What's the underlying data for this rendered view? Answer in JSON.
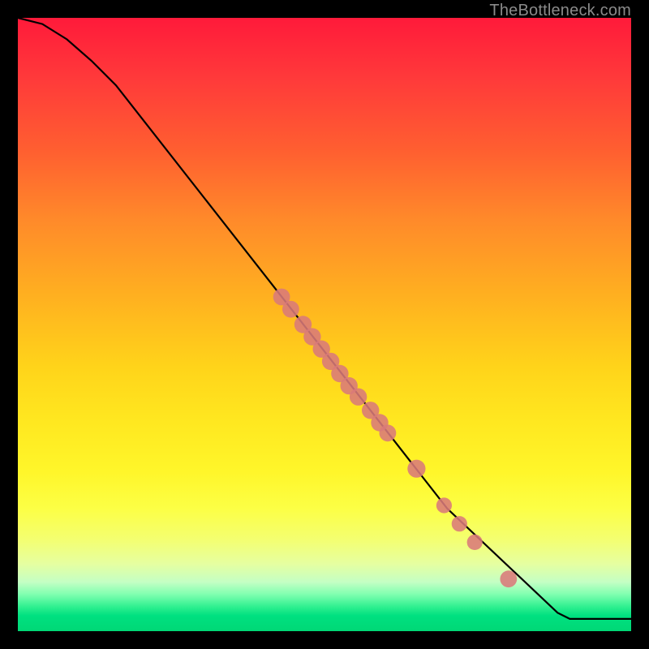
{
  "watermark": "TheBottleneck.com",
  "chart_data": {
    "type": "line",
    "title": "",
    "xlabel": "",
    "ylabel": "",
    "xlim": [
      0,
      100
    ],
    "ylim": [
      0,
      100
    ],
    "curve": [
      {
        "x": 0,
        "y": 100
      },
      {
        "x": 4,
        "y": 99
      },
      {
        "x": 8,
        "y": 96.5
      },
      {
        "x": 12,
        "y": 93
      },
      {
        "x": 16,
        "y": 89
      },
      {
        "x": 45,
        "y": 52
      },
      {
        "x": 70,
        "y": 20
      },
      {
        "x": 88,
        "y": 3
      },
      {
        "x": 90,
        "y": 2
      },
      {
        "x": 100,
        "y": 2
      }
    ],
    "markers": [
      {
        "x": 43,
        "y": 54.5,
        "r": 1.2
      },
      {
        "x": 44.5,
        "y": 52.5,
        "r": 1.2
      },
      {
        "x": 46.5,
        "y": 50,
        "r": 1.3
      },
      {
        "x": 48,
        "y": 48,
        "r": 1.3
      },
      {
        "x": 49.5,
        "y": 46,
        "r": 1.3
      },
      {
        "x": 51,
        "y": 44,
        "r": 1.3
      },
      {
        "x": 52.5,
        "y": 42,
        "r": 1.3
      },
      {
        "x": 54,
        "y": 40,
        "r": 1.3
      },
      {
        "x": 55.5,
        "y": 38.2,
        "r": 1.3
      },
      {
        "x": 57.5,
        "y": 36,
        "r": 1.3
      },
      {
        "x": 59,
        "y": 34,
        "r": 1.3
      },
      {
        "x": 60.3,
        "y": 32.3,
        "r": 1.2
      },
      {
        "x": 65,
        "y": 26.5,
        "r": 1.4
      },
      {
        "x": 69.5,
        "y": 20.5,
        "r": 1.0
      },
      {
        "x": 72,
        "y": 17.5,
        "r": 1.0
      },
      {
        "x": 74.5,
        "y": 14.5,
        "r": 1.0
      },
      {
        "x": 80,
        "y": 8.5,
        "r": 1.2
      }
    ]
  }
}
